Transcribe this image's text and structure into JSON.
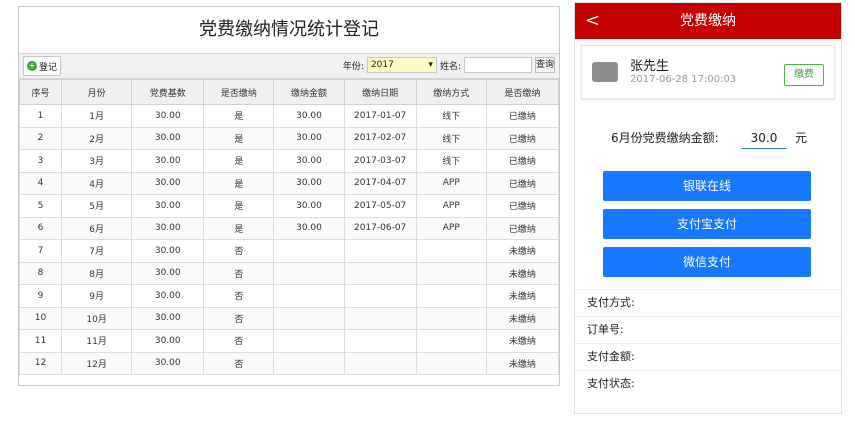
{
  "left": {
    "title": "党费缴纳情况统计登记",
    "register_label": "登记",
    "year_label": "年份:",
    "year_value": "2017",
    "name_label": "姓名:",
    "name_value": "",
    "query_label": "查询",
    "columns": [
      "序号",
      "月份",
      "党费基数",
      "是否缴纳",
      "缴纳金额",
      "缴纳日期",
      "缴纳方式",
      "是否缴纳"
    ],
    "rows": [
      [
        "1",
        "1月",
        "30.00",
        "是",
        "30.00",
        "2017-01-07",
        "线下",
        "已缴纳"
      ],
      [
        "2",
        "2月",
        "30.00",
        "是",
        "30.00",
        "2017-02-07",
        "线下",
        "已缴纳"
      ],
      [
        "3",
        "3月",
        "30.00",
        "是",
        "30.00",
        "2017-03-07",
        "线下",
        "已缴纳"
      ],
      [
        "4",
        "4月",
        "30.00",
        "是",
        "30.00",
        "2017-04-07",
        "APP",
        "已缴纳"
      ],
      [
        "5",
        "5月",
        "30.00",
        "是",
        "30.00",
        "2017-05-07",
        "APP",
        "已缴纳"
      ],
      [
        "6",
        "6月",
        "30.00",
        "是",
        "30.00",
        "2017-06-07",
        "APP",
        "已缴纳"
      ],
      [
        "7",
        "7月",
        "30.00",
        "否",
        "",
        "",
        "",
        "未缴纳"
      ],
      [
        "8",
        "8月",
        "30.00",
        "否",
        "",
        "",
        "",
        "未缴纳"
      ],
      [
        "9",
        "9月",
        "30.00",
        "否",
        "",
        "",
        "",
        "未缴纳"
      ],
      [
        "10",
        "10月",
        "30.00",
        "否",
        "",
        "",
        "",
        "未缴纳"
      ],
      [
        "11",
        "11月",
        "30.00",
        "否",
        "",
        "",
        "",
        "未缴纳"
      ],
      [
        "12",
        "12月",
        "30.00",
        "否",
        "",
        "",
        "",
        "未缴纳"
      ]
    ]
  },
  "right": {
    "back_glyph": "<",
    "header_title": "党费缴纳",
    "user_name": "张先生",
    "user_time": "2017-06-28 17:00:03",
    "pay_button": "缴费",
    "amount_label": "6月份党费缴纳金额:",
    "amount_value": "30.0",
    "amount_unit": "元",
    "pay_options": [
      "银联在线",
      "支付宝支付",
      "微信支付"
    ],
    "info_labels": [
      "支付方式:",
      "订单号:",
      "支付金额:",
      "支付状态:"
    ],
    "colors": {
      "header": "#c40000",
      "pay_option": "#1677ff",
      "pay_button": "#4caf50"
    }
  }
}
